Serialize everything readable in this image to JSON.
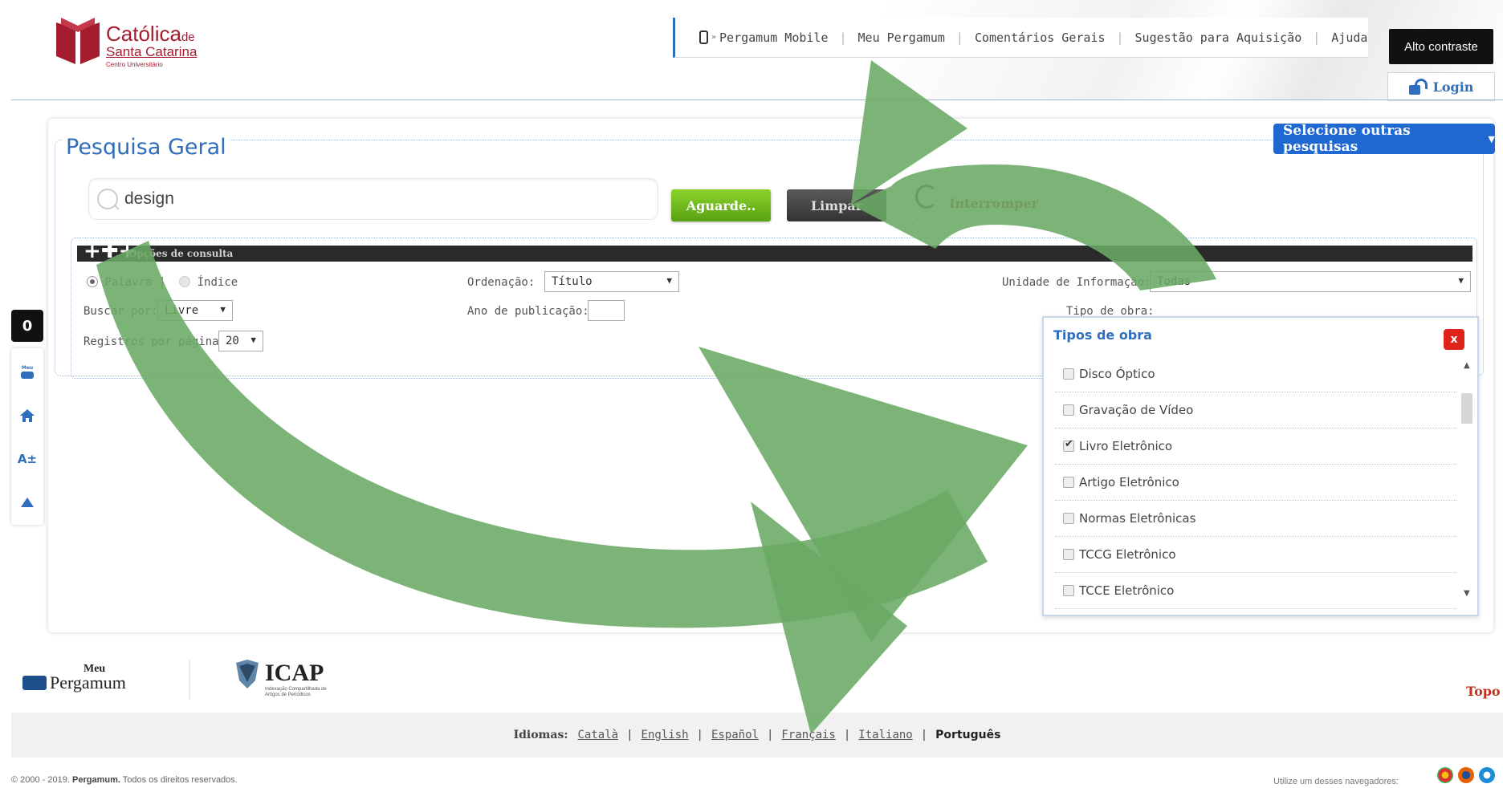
{
  "brand": {
    "name": "Católica",
    "name_suffix": "de",
    "line2": "Santa Catarina",
    "line3": "Centro Universitário"
  },
  "topnav": {
    "items": [
      "Pergamum Mobile",
      "Meu Pergamum",
      "Comentários Gerais",
      "Sugestão para Aquisição",
      "Ajuda"
    ]
  },
  "accessibility": {
    "high_contrast": "Alto contraste"
  },
  "login": {
    "label": "Login"
  },
  "search": {
    "legend": "Pesquisa Geral",
    "other_searches": "Selecione outras pesquisas",
    "query": "design",
    "submit_label": "Aguarde..",
    "clear_label": "Limpar",
    "stop_label": "Interromper"
  },
  "options": {
    "bar_label": "Opções de consulta",
    "radio_word": "Palavra",
    "radio_index": "Índice",
    "sep": "|",
    "order_label": "Ordenação:",
    "order_value": "Título",
    "unit_label": "Unidade de Informação:",
    "unit_value": "Todas",
    "search_by_label": "Buscar por:",
    "search_by_value": "Livre",
    "year_label": "Ano de publicação:",
    "year_value": "",
    "work_type_label": "Tipo de obra:",
    "per_page_label": "Registros por página:",
    "per_page_value": "20"
  },
  "tipos": {
    "title": "Tipos de obra",
    "close": "x",
    "items": [
      {
        "label": "Disco Óptico",
        "checked": false
      },
      {
        "label": "Gravação de Vídeo",
        "checked": false
      },
      {
        "label": "Livro Eletrônico",
        "checked": true
      },
      {
        "label": "Artigo Eletrônico",
        "checked": false
      },
      {
        "label": "Normas Eletrônicas",
        "checked": false
      },
      {
        "label": "TCCG Eletrônico",
        "checked": false
      },
      {
        "label": "TCCE Eletrônico",
        "checked": false
      }
    ]
  },
  "sidebar": {
    "contrast": "0",
    "meu": "Meu",
    "font": "A±"
  },
  "footer": {
    "meu": "Meu",
    "pergamum": "Pergamum",
    "icap": "ICAP",
    "icap_sub": "Indexação Compartilhada de Artigos de Periódicos",
    "topo": "Topo",
    "idiomas_label": "Idiomas:",
    "languages": [
      "Català",
      "English",
      "Español",
      "Français",
      "Italiano"
    ],
    "current_language": "Português",
    "copyright_pre": "© 2000 - 2019.",
    "copyright_brand": "Pergamum.",
    "copyright_post": "Todos os direitos reservados.",
    "browsers": "Utilize um desses navegadores:"
  },
  "colors": {
    "brand_red": "#a51c30",
    "link_blue": "#2f6ebd",
    "accent_green": "#5aa213",
    "overlay_green": "#6aaa64"
  }
}
